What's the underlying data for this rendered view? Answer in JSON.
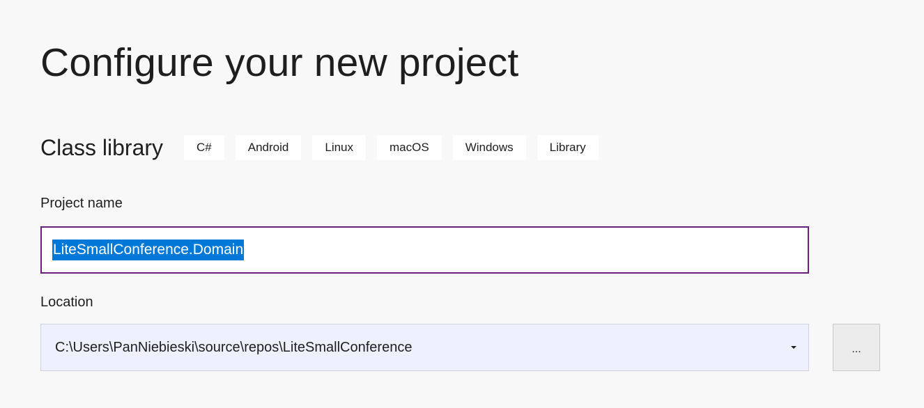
{
  "header": {
    "title": "Configure your new project"
  },
  "template": {
    "name": "Class library",
    "tags": [
      "C#",
      "Android",
      "Linux",
      "macOS",
      "Windows",
      "Library"
    ]
  },
  "project_name": {
    "label": "Project name",
    "value": "LiteSmallConference.Domain"
  },
  "location": {
    "label": "Location",
    "value": "C:\\Users\\PanNiebieski\\source\\repos\\LiteSmallConference",
    "dropdown_icon": "chevron-down-icon",
    "browse_label": "..."
  },
  "colors": {
    "background": "#f8f8f8",
    "focus_border": "#68217a",
    "selection": "#0078d7",
    "location_background": "#eef0fd"
  }
}
